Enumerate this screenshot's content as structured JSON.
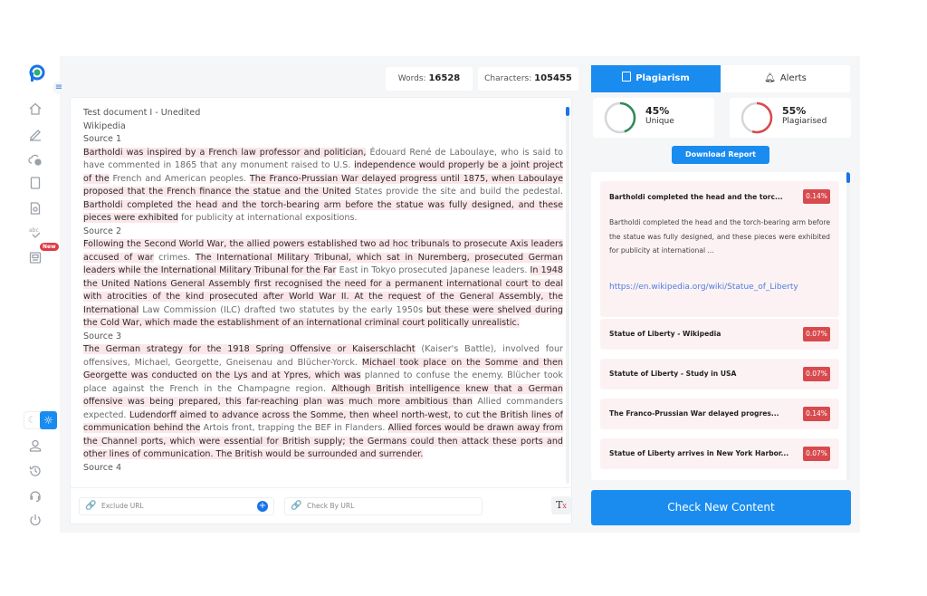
{
  "sidebar": {
    "logo": "p-logo-icon",
    "items": [
      {
        "name": "home",
        "icon": "home-icon"
      },
      {
        "name": "edit",
        "icon": "pencil-icon"
      },
      {
        "name": "cloud-settings",
        "icon": "cloud-gear-icon"
      },
      {
        "name": "document",
        "icon": "document-icon"
      },
      {
        "name": "report",
        "icon": "file-report-icon"
      },
      {
        "name": "spell-check",
        "icon": "abc-check-icon"
      },
      {
        "name": "news",
        "icon": "newspaper-icon",
        "badge": "New"
      },
      {
        "name": "profile",
        "icon": "user-icon"
      },
      {
        "name": "history",
        "icon": "history-icon"
      },
      {
        "name": "support",
        "icon": "headset-icon"
      },
      {
        "name": "logout",
        "icon": "power-icon"
      }
    ],
    "new_badge": "New"
  },
  "stats": {
    "words_label": "Words:",
    "words_value": "16528",
    "chars_label": "Characters:",
    "chars_value": "105455"
  },
  "document": {
    "title": "Test document I - Unedited",
    "subtitle": "Wikipedia",
    "sources": [
      {
        "label": "Source 1",
        "segments": [
          {
            "t": "Bartholdi was inspired by a French law professor and politician,",
            "h": true
          },
          {
            "t": " Édouard René de Laboulaye, who is said to have commented in 1865 that any monument raised to U.S. ",
            "h": false
          },
          {
            "t": "independence would properly be a joint project of the",
            "h": true
          },
          {
            "t": " French and American peoples. ",
            "h": false
          },
          {
            "t": "The Franco-Prussian War delayed progress until 1875, when Laboulaye proposed that the French finance the statue and the United",
            "h": true
          },
          {
            "t": " States provide the site and build the pedestal. ",
            "h": false
          },
          {
            "t": "Bartholdi completed the head and the torch-bearing arm before the statue was fully designed, and these pieces were exhibited",
            "h": true
          },
          {
            "t": " for publicity at international expositions.",
            "h": false
          }
        ]
      },
      {
        "label": "Source 2",
        "segments": [
          {
            "t": "Following the Second World War, the allied powers established two ad hoc tribunals to prosecute Axis leaders accused of war",
            "h": true
          },
          {
            "t": " crimes. ",
            "h": false
          },
          {
            "t": "The International Military Tribunal, which sat in Nuremberg, prosecuted German leaders while the International Military Tribunal for the Far",
            "h": true
          },
          {
            "t": " East in Tokyo prosecuted Japanese leaders. ",
            "h": false
          },
          {
            "t": "In 1948 the United Nations General Assembly first recognised the need for a permanent international court to deal with atrocities of the kind prosecuted after World War II. At the request of the General Assembly, the International",
            "h": true
          },
          {
            "t": " Law Commission (ILC) drafted two statutes by the early 1950s ",
            "h": false
          },
          {
            "t": "but these were shelved during the Cold War, which made the establishment of an international criminal court politically unrealistic.",
            "h": true
          }
        ]
      },
      {
        "label": "Source 3",
        "segments": [
          {
            "t": "The German strategy for the 1918 Spring Offensive or Kaiserschlacht",
            "h": true
          },
          {
            "t": " (Kaiser's Battle), involved four offensives, Michael, Georgette, Gneisenau and Blücher-Yorck. ",
            "h": false
          },
          {
            "t": "Michael took place on the Somme and then Georgette was conducted on the Lys and at Ypres, which was",
            "h": true
          },
          {
            "t": " planned to confuse the enemy. Blücher took place against the French in the Champagne region. ",
            "h": false
          },
          {
            "t": "Although British intelligence knew that a German offensive was being prepared, this far-reaching plan was much more ambitious than",
            "h": true
          },
          {
            "t": " Allied commanders expected. ",
            "h": false
          },
          {
            "t": "Ludendorff aimed to advance across the Somme, then wheel north-west, to cut the British lines of communication behind the",
            "h": true
          },
          {
            "t": " Artois front, trapping the BEF in Flanders. ",
            "h": false
          },
          {
            "t": "Allied forces would be drawn away from the Channel ports, which were essential for British supply; the Germans could then attack these ports and other lines of communication. The British would be surrounded and surrender.",
            "h": true
          }
        ]
      },
      {
        "label": "Source 4",
        "segments": []
      }
    ]
  },
  "footer": {
    "exclude_url_placeholder": "Exclude URL",
    "check_url_placeholder": "Check By URL",
    "clear_format_icon": "clear-formatting-icon"
  },
  "panel": {
    "tabs": [
      {
        "label": "Plagiarism",
        "icon": "report-icon",
        "active": true
      },
      {
        "label": "Alerts",
        "icon": "bell-icon",
        "active": false
      }
    ],
    "unique": {
      "value": "45%",
      "label": "Unique",
      "fraction": 0.45,
      "color": "#2e8b57"
    },
    "plagiarised": {
      "value": "55%",
      "label": "Plagiarised",
      "fraction": 0.55,
      "color": "#d84a4d"
    },
    "download_label": "Download Report",
    "results": [
      {
        "title": "Bartholdi completed the head and the torc...",
        "percent": "0.14%",
        "excerpt": "Bartholdi completed the head and the torch-bearing arm before the statue was fully designed, and these pieces were exhibited for publicity at international ...",
        "url": "https://en.wikipedia.org/wiki/Statue_of_Liberty"
      },
      {
        "title": "Statue of Liberty - Wikipedia",
        "percent": "0.07%"
      },
      {
        "title": "Statute of Liberty - Study in USA",
        "percent": "0.07%"
      },
      {
        "title": "The Franco-Prussian War delayed progres...",
        "percent": "0.14%"
      },
      {
        "title": "Statue of Liberty arrives in New York Harbor...",
        "percent": "0.07%"
      }
    ],
    "check_new_label": "Check New Content"
  }
}
